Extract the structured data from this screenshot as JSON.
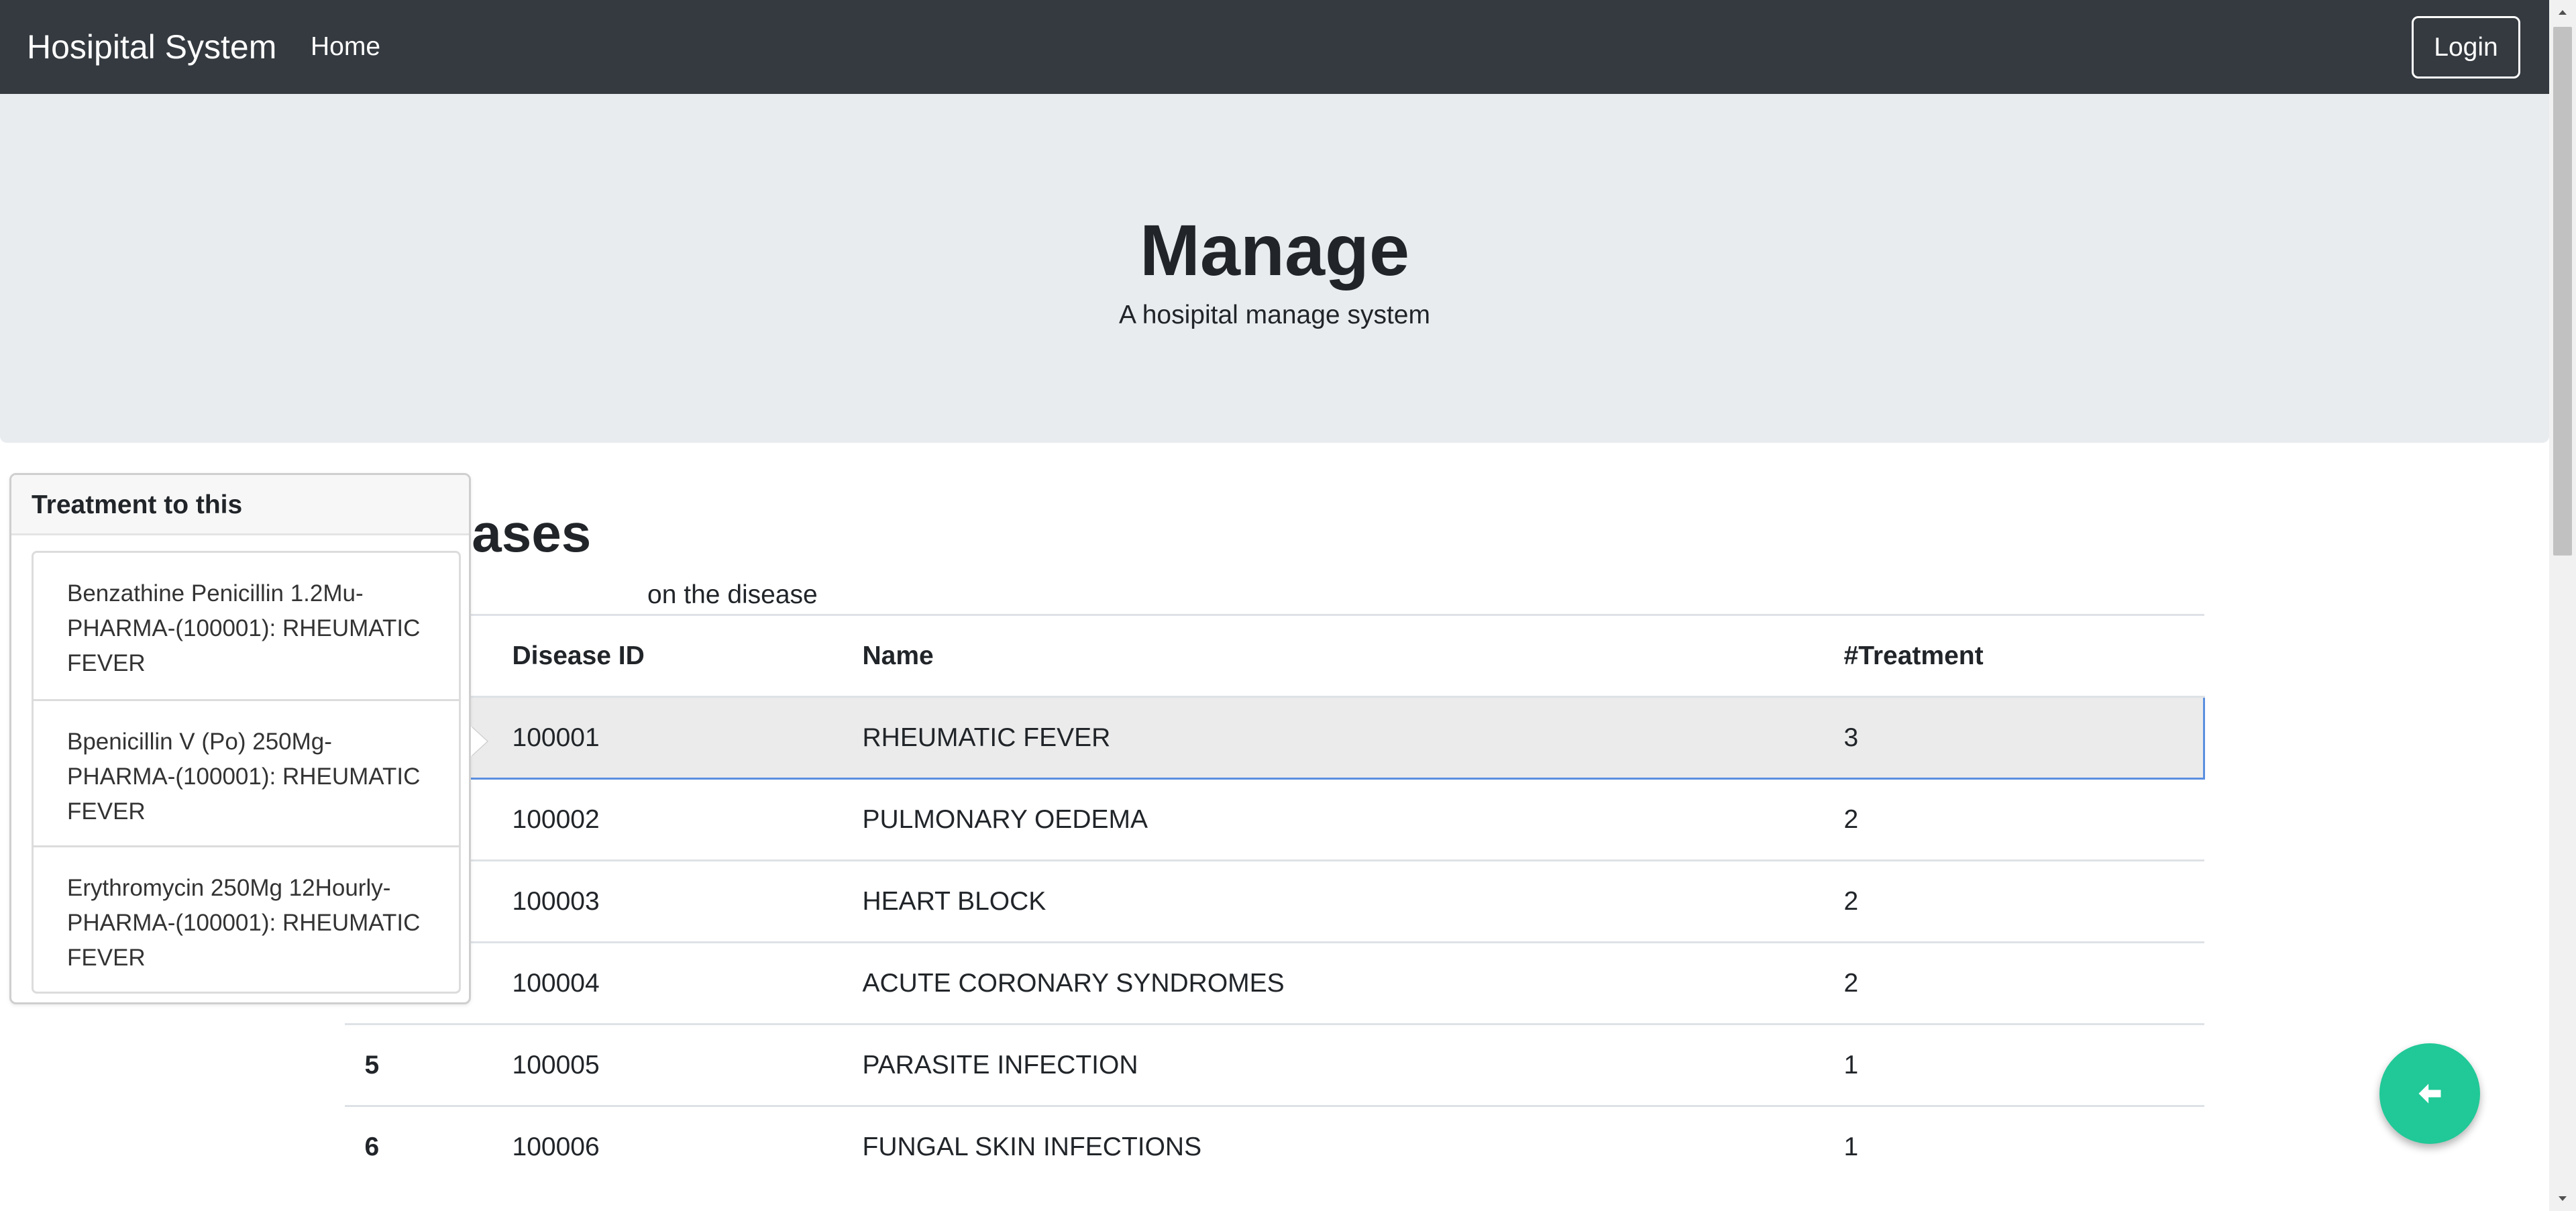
{
  "navbar": {
    "brand": "Hosipital System",
    "home_label": "Home",
    "login_label": "Login"
  },
  "jumbotron": {
    "title": "Manage",
    "lead": "A hosipital manage system"
  },
  "section": {
    "title_visible": "iseases",
    "description_visible": "on the disease"
  },
  "table": {
    "headers": [
      "",
      "Disease ID",
      "Name",
      "#Treatment"
    ],
    "rows": [
      {
        "num": "",
        "id": "100001",
        "name": "RHEUMATIC FEVER",
        "treatments": "3",
        "selected": true
      },
      {
        "num": "",
        "id": "100002",
        "name": "PULMONARY OEDEMA",
        "treatments": "2"
      },
      {
        "num": "",
        "id": "100003",
        "name": "HEART BLOCK",
        "treatments": "2"
      },
      {
        "num": "",
        "id": "100004",
        "name": "ACUTE CORONARY SYNDROMES",
        "treatments": "2"
      },
      {
        "num": "5",
        "id": "100005",
        "name": "PARASITE INFECTION",
        "treatments": "1"
      },
      {
        "num": "6",
        "id": "100006",
        "name": "FUNGAL SKIN INFECTIONS",
        "treatments": "1"
      }
    ]
  },
  "popover": {
    "header": "Treatment to this",
    "items": [
      "Benzathine Penicillin 1.2Mu-PHARMA-(100001): RHEUMATIC FEVER",
      "Bpenicillin V (Po) 250Mg-PHARMA-(100001): RHEUMATIC FEVER",
      "Erythromycin 250Mg 12Hourly-PHARMA-(100001): RHEUMATIC FEVER"
    ]
  },
  "fab": {
    "icon": "arrow-left-icon"
  },
  "colors": {
    "navbar_bg": "#343a40",
    "jumbotron_bg": "#e9ecef",
    "fab_bg": "#20c997",
    "selected_row_border": "#5b8fe0"
  }
}
